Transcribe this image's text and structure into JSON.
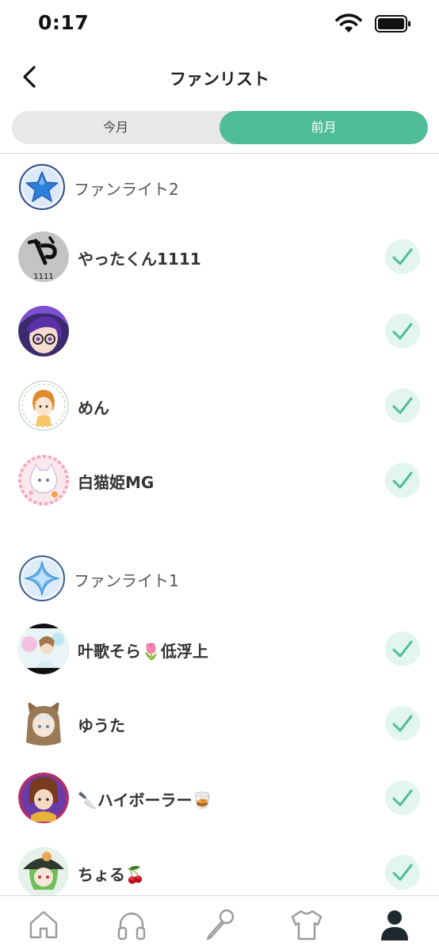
{
  "status_bar": {
    "time": "0:17"
  },
  "nav": {
    "title": "ファンリスト"
  },
  "segment": {
    "left_label": "今月",
    "right_label": "前月",
    "selected": "前月"
  },
  "sections": [
    {
      "label": "ファンライト2",
      "badge_icon": "blue-star-badge-icon",
      "fans": [
        {
          "name": "やったくん1111",
          "checked": true
        },
        {
          "name": "",
          "checked": true
        },
        {
          "name": "めん",
          "checked": true
        },
        {
          "name": "白猫姫MG",
          "checked": true
        }
      ]
    },
    {
      "label": "ファンライト1",
      "badge_icon": "light-blue-sparkle-badge-icon",
      "fans": [
        {
          "name": "叶歌そら🌷低浮上",
          "checked": true
        },
        {
          "name": "ゆうた",
          "checked": true
        },
        {
          "name": "🔪ハイボーラー🥃",
          "checked": true
        },
        {
          "name": "ちょる🍒",
          "checked": true
        }
      ]
    }
  ],
  "avatar_text": {
    "yatta": "1111"
  },
  "tab_bar": [
    "home-icon",
    "headphones-icon",
    "microphone-icon",
    "shirt-icon",
    "profile-icon"
  ],
  "colors": {
    "accent": "#4fbc9a",
    "check_bg": "#e2f5ee",
    "check": "#4fbc9a"
  }
}
